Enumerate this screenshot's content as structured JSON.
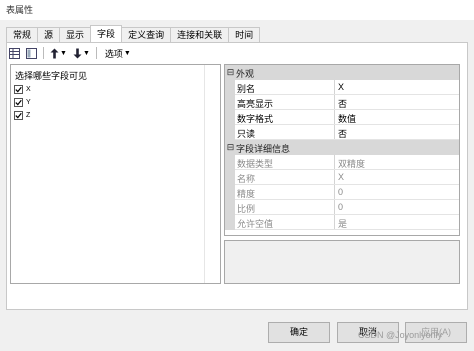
{
  "window": {
    "title": "表属性"
  },
  "tabs": [
    {
      "label": "常规",
      "active": false
    },
    {
      "label": "源",
      "active": false
    },
    {
      "label": "显示",
      "active": false
    },
    {
      "label": "字段",
      "active": true
    },
    {
      "label": "定义查询",
      "active": false
    },
    {
      "label": "连接和关联",
      "active": false
    },
    {
      "label": "时间",
      "active": false
    }
  ],
  "toolbar": {
    "items": [
      "table-view-icon",
      "list-view-icon",
      "move-up-icon",
      "move-down-icon"
    ],
    "options_label": "选项"
  },
  "field_list": {
    "heading": "选择哪些字段可见",
    "fields": [
      {
        "name": "X",
        "checked": true
      },
      {
        "name": "Y",
        "checked": true
      },
      {
        "name": "Z",
        "checked": true
      }
    ]
  },
  "properties": {
    "appearance": {
      "title": "外观",
      "rows": [
        {
          "name": "别名",
          "value": "X"
        },
        {
          "name": "高亮显示",
          "value": "否"
        },
        {
          "name": "数字格式",
          "value": "数值"
        },
        {
          "name": "只读",
          "value": "否"
        }
      ]
    },
    "details": {
      "title": "字段详细信息",
      "rows": [
        {
          "name": "数据类型",
          "value": "双精度"
        },
        {
          "name": "名称",
          "value": "X"
        },
        {
          "name": "精度",
          "value": "0"
        },
        {
          "name": "比例",
          "value": "0"
        },
        {
          "name": "允许空值",
          "value": "是"
        }
      ]
    }
  },
  "buttons": {
    "ok": "确定",
    "cancel": "取消",
    "apply": "应用(A)"
  },
  "watermark": "CSDN @Joyonlyonly"
}
